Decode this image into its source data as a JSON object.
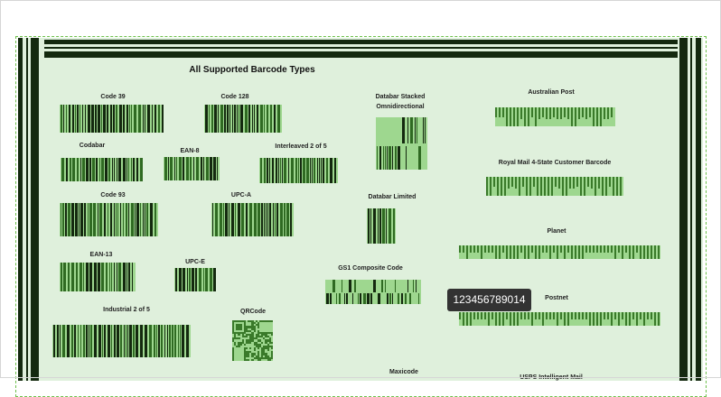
{
  "title": "All Supported Barcode Types",
  "barcodes": [
    {
      "id": "code39",
      "label": "Code 39"
    },
    {
      "id": "code128",
      "label": "Code 128"
    },
    {
      "id": "codabar",
      "label": "Codabar"
    },
    {
      "id": "ean8",
      "label": "EAN-8"
    },
    {
      "id": "itf",
      "label": "Interleaved 2 of 5"
    },
    {
      "id": "code93",
      "label": "Code 93"
    },
    {
      "id": "upca",
      "label": "UPC-A"
    },
    {
      "id": "ean13",
      "label": "EAN-13"
    },
    {
      "id": "upce",
      "label": "UPC-E"
    },
    {
      "id": "industrial",
      "label": "Industrial 2 of 5"
    },
    {
      "id": "qrcode",
      "label": "QRCode"
    },
    {
      "id": "databar-stacked",
      "label": "Databar Stacked Omnidirectional"
    },
    {
      "id": "databar-limited",
      "label": "Databar Limited"
    },
    {
      "id": "gs1",
      "label": "GS1 Composite Code"
    },
    {
      "id": "maxicode",
      "label": "Maxicode"
    },
    {
      "id": "auspost",
      "label": "Australian Post"
    },
    {
      "id": "royalmail",
      "label": "Royal Mail 4-State Customer Barcode"
    },
    {
      "id": "planet",
      "label": "Planet"
    },
    {
      "id": "postnet",
      "label": "Postnet"
    },
    {
      "id": "usps",
      "label": "USPS Intelligent Mail"
    }
  ],
  "tooltip": {
    "text": "123456789014"
  },
  "colors": {
    "background": "#dff0dc",
    "bar": "#3a7a2a",
    "dark": "#14290f",
    "highlight": "#9ed78f"
  }
}
